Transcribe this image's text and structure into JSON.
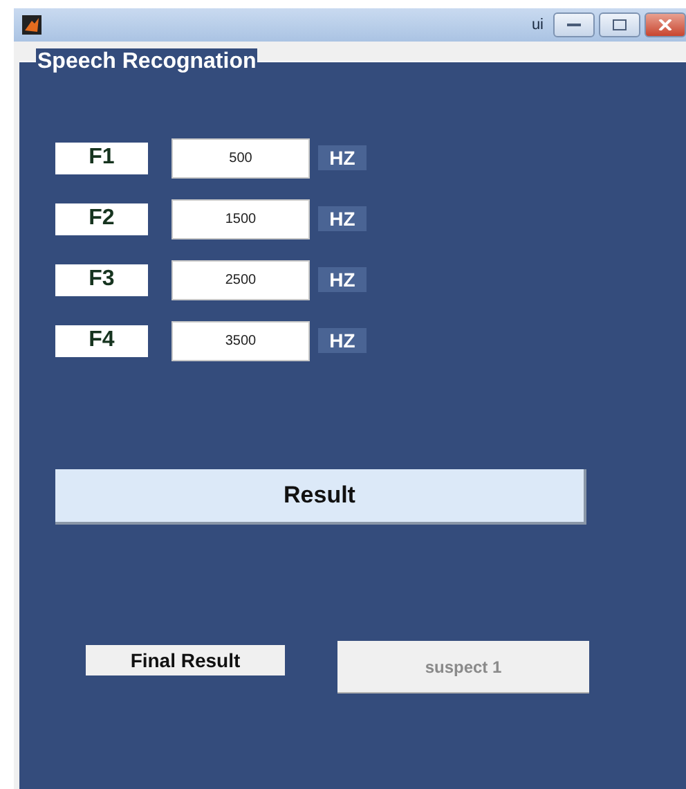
{
  "window": {
    "title": "ui"
  },
  "panel": {
    "title": "Speech Recognation"
  },
  "formants": [
    {
      "label": "F1",
      "value": "500",
      "unit": "HZ"
    },
    {
      "label": "F2",
      "value": "1500",
      "unit": "HZ"
    },
    {
      "label": "F3",
      "value": "2500",
      "unit": "HZ"
    },
    {
      "label": "F4",
      "value": "3500",
      "unit": "HZ"
    }
  ],
  "result_button": {
    "label": "Result"
  },
  "final_result": {
    "label": "Final Result",
    "value": "suspect 1",
    "disabled": true
  }
}
